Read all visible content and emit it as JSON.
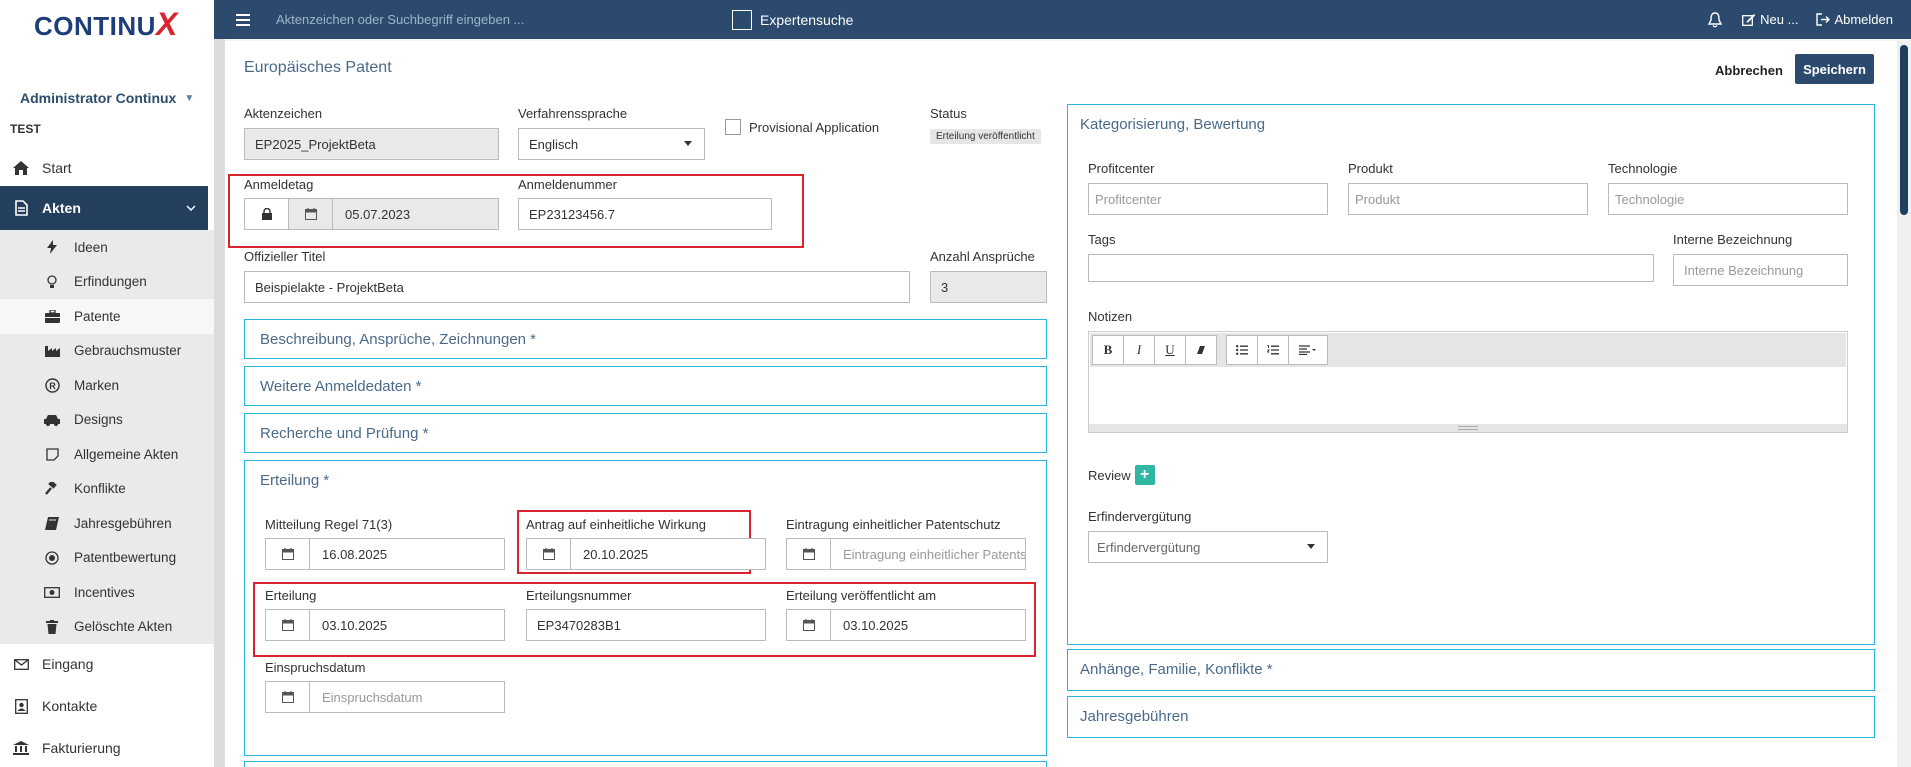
{
  "brand": {
    "logo_text_a": "CONTIN",
    "logo_text_u": "U",
    "logo_text_x": "X"
  },
  "sidebar": {
    "user": "Administrator Continux",
    "org": "TEST",
    "start": "Start",
    "akten": "Akten",
    "subitems": [
      {
        "label": "Ideen",
        "icon": "bolt-icon"
      },
      {
        "label": "Erfindungen",
        "icon": "lightbulb-icon"
      },
      {
        "label": "Patente",
        "icon": "briefcase-icon"
      },
      {
        "label": "Gebrauchsmuster",
        "icon": "industry-icon"
      },
      {
        "label": "Marken",
        "icon": "registered-icon"
      },
      {
        "label": "Designs",
        "icon": "car-icon"
      },
      {
        "label": "Allgemeine Akten",
        "icon": "note-icon"
      },
      {
        "label": "Konflikte",
        "icon": "gavel-icon"
      },
      {
        "label": "Jahresgebühren",
        "icon": "book-icon"
      },
      {
        "label": "Patentbewertung",
        "icon": "circle-dot-icon"
      },
      {
        "label": "Incentives",
        "icon": "money-icon"
      },
      {
        "label": "Gelöschte Akten",
        "icon": "trash-icon"
      }
    ],
    "eingang": "Eingang",
    "kontakte": "Kontakte",
    "fakturierung": "Fakturierung"
  },
  "topbar": {
    "search_placeholder": "Aktenzeichen oder Suchbegriff eingeben ...",
    "expert": "Expertensuche",
    "neu": "Neu ...",
    "abmelden": "Abmelden"
  },
  "page": {
    "title": "Europäisches Patent",
    "cancel": "Abbrechen",
    "save": "Speichern"
  },
  "form": {
    "aktenzeichen_label": "Aktenzeichen",
    "aktenzeichen": "EP2025_ProjektBeta",
    "sprache_label": "Verfahrenssprache",
    "sprache": "Englisch",
    "provisional": "Provisional Application",
    "status_label": "Status",
    "status": "Erteilung veröffentlicht",
    "anmeldetag_label": "Anmeldetag",
    "anmeldetag": "05.07.2023",
    "anmeldenummer_label": "Anmeldenummer",
    "anmeldenummer": "EP23123456.7",
    "titel_label": "Offizieller Titel",
    "titel": "Beispielakte - ProjektBeta",
    "ansprueche_label": "Anzahl Ansprüche",
    "ansprueche": "3"
  },
  "sections": {
    "beschreibung": "Beschreibung, Ansprüche, Zeichnungen *",
    "weitere": "Weitere Anmeldedaten *",
    "recherche": "Recherche und Prüfung *",
    "erteilung": "Erteilung *"
  },
  "erteilung": {
    "regel_label": "Mitteilung Regel 71(3)",
    "regel": "16.08.2025",
    "antrag_label": "Antrag auf einheitliche Wirkung",
    "antrag": "20.10.2025",
    "eintragung_label": "Eintragung einheitlicher Patentschutz",
    "eintragung_placeholder": "Eintragung einheitlicher Patentschutz",
    "erteilung_label": "Erteilung",
    "erteilung": "03.10.2025",
    "nummer_label": "Erteilungsnummer",
    "nummer": "EP3470283B1",
    "veroeff_label": "Erteilung veröffentlicht am",
    "veroeff": "03.10.2025",
    "einspruch_label": "Einspruchsdatum",
    "einspruch_placeholder": "Einspruchsdatum"
  },
  "kategorie": {
    "title": "Kategorisierung, Bewertung",
    "profitcenter_label": "Profitcenter",
    "profitcenter_ph": "Profitcenter",
    "produkt_label": "Produkt",
    "produkt_ph": "Produkt",
    "technologie_label": "Technologie",
    "technologie_ph": "Technologie",
    "tags_label": "Tags",
    "interne_label": "Interne Bezeichnung",
    "interne_ph": "Interne Bezeichnung",
    "notizen_label": "Notizen",
    "review_label": "Review",
    "verguetung_label": "Erfindervergütung",
    "verguetung": "Erfindervergütung",
    "toolbar": {
      "bold": "B",
      "italic": "I",
      "underline": "U"
    }
  },
  "right_sections": {
    "anhaenge": "Anhänge, Familie, Konflikte *",
    "jahres": "Jahresgebühren"
  }
}
